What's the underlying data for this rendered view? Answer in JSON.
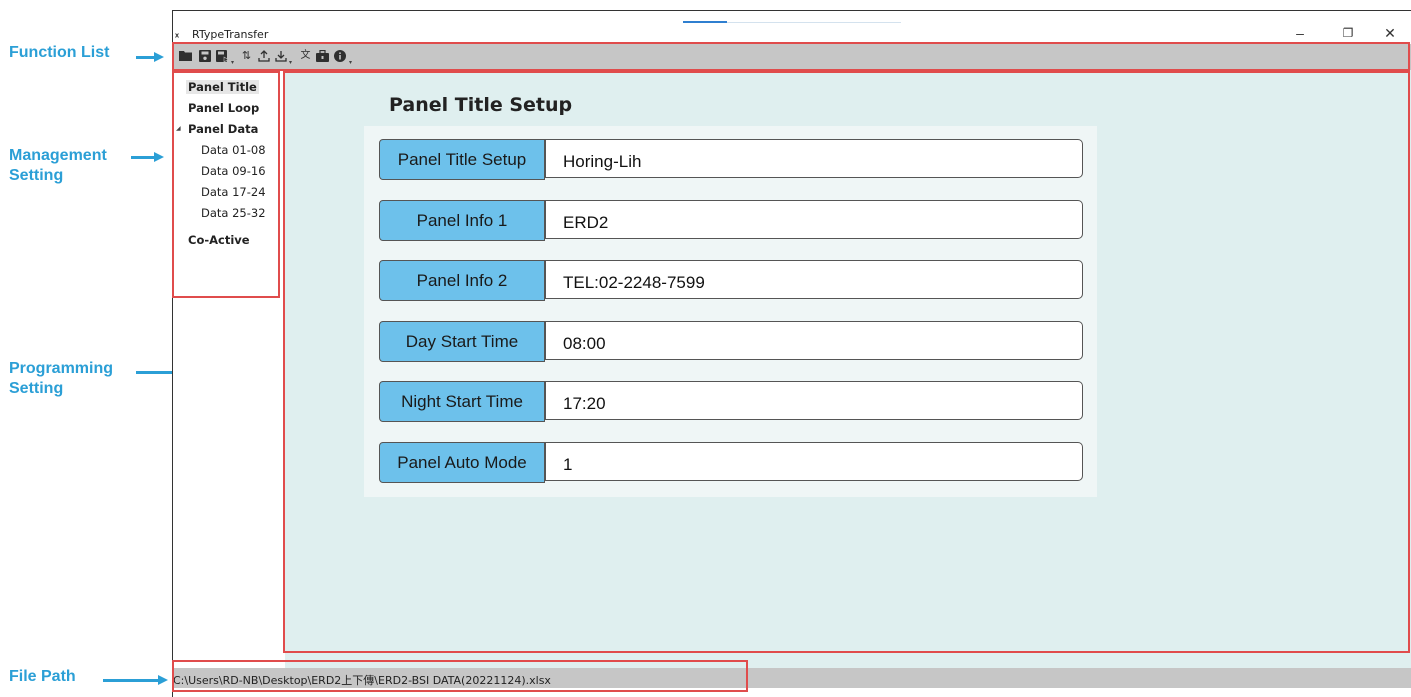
{
  "colors": {
    "callout": "#2b9fd6",
    "highlight": "#e04c4c",
    "label_bg": "#6dc1eb",
    "content_bg": "#dfefef",
    "toolbar_bg": "#c6c6c6"
  },
  "annotations": {
    "function_list": "Function List",
    "management_setting": "Management\nSetting",
    "programming_setting": "Programming\nSetting",
    "file_path": "File Path"
  },
  "window": {
    "app_icon": "app-logo-icon",
    "title": "RTypeTransfer",
    "controls": [
      "minimize-icon",
      "restore-icon",
      "close-icon"
    ]
  },
  "toolbar": {
    "icons": [
      "open-folder-icon",
      "save-icon",
      "save-as-icon",
      "transfer-icon",
      "upload-icon",
      "download-icon",
      "language-icon",
      "toolbox-icon",
      "info-icon"
    ]
  },
  "sidebar": {
    "items": [
      {
        "label": "Panel Title"
      },
      {
        "label": "Panel Loop"
      },
      {
        "label": "Panel Data"
      },
      {
        "label": "Data 01-08"
      },
      {
        "label": "Data 09-16"
      },
      {
        "label": "Data 17-24"
      },
      {
        "label": "Data 25-32"
      },
      {
        "label": "Co-Active"
      }
    ]
  },
  "main": {
    "heading": "Panel Title Setup",
    "fields": [
      {
        "label": "Panel Title Setup",
        "value": "Horing-Lih"
      },
      {
        "label": "Panel Info 1",
        "value": "ERD2"
      },
      {
        "label": "Panel Info 2",
        "value": "TEL:02-2248-7599"
      },
      {
        "label": "Day Start Time",
        "value": "08:00"
      },
      {
        "label": "Night Start Time",
        "value": "17:20"
      },
      {
        "label": "Panel Auto Mode",
        "value": "1"
      }
    ]
  },
  "status": {
    "file_path": "C:\\Users\\RD-NB\\Desktop\\ERD2上下傳\\ERD2-BSI DATA(20221124).xlsx"
  }
}
